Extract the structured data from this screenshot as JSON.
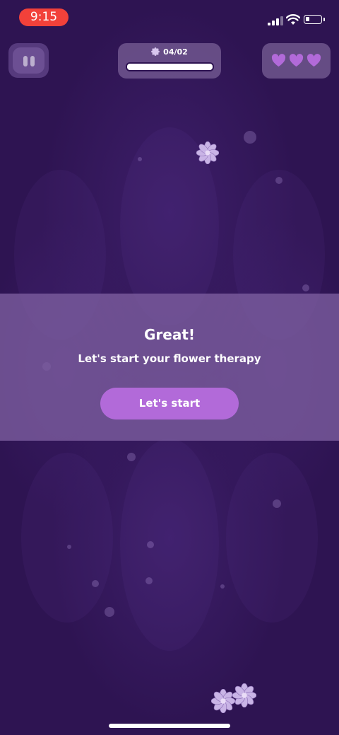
{
  "status_bar": {
    "time": "9:15"
  },
  "hud": {
    "progress_label": "04/02",
    "progress_fraction": 1.0,
    "lives": 3,
    "heart_color": "#b26ad9"
  },
  "dialog": {
    "title": "Great!",
    "subtitle": "Let's start your flower therapy",
    "button_label": "Let's start"
  },
  "colors": {
    "background": "#2e1452",
    "accent": "#b26ad9",
    "status_pill": "#f2413a"
  },
  "icons": {
    "pause": "pause-icon",
    "heart": "heart-icon",
    "flower": "flower-icon"
  }
}
